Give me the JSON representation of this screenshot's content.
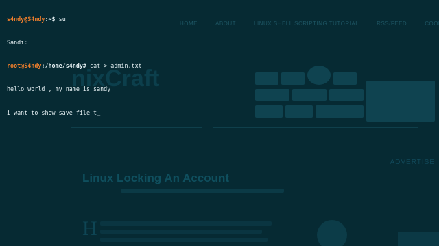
{
  "background_page": {
    "nav_items": [
      "HOME",
      "ABOUT",
      "LINUX SHELL SCRIPTING TUTORIAL",
      "RSS/FEED",
      "COOL"
    ],
    "logo": "nixCraft",
    "advertisement_label": "ADVERTISE",
    "article_title": "Linux Locking An Account",
    "drop_cap": "H"
  },
  "terminal": {
    "prompt1_user": "s4ndy@S4ndy",
    "prompt1_path": ":~$",
    "prompt1_cmd": " su",
    "line2": "Sandi:",
    "prompt3_user": "root@S4ndy",
    "prompt3_path": ":/home/s4ndy#",
    "prompt3_cmd": " cat > admin.txt",
    "line4": "hello world , my name is sandy",
    "line5": "i want to show save file t_"
  },
  "colors": {
    "background": "#062a33",
    "prompt": "#f07f2c",
    "text": "#e4eff2"
  },
  "mouse_cursor": "I"
}
